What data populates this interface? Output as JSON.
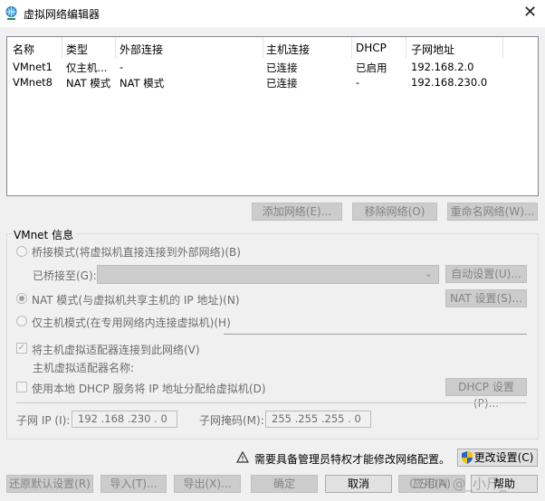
{
  "window": {
    "title": "虚拟网络编辑器",
    "icon": "globe-network-icon",
    "close": "✕"
  },
  "table": {
    "headers": [
      "名称",
      "类型",
      "外部连接",
      "主机连接",
      "DHCP",
      "子网地址"
    ],
    "rows": [
      [
        "VMnet1",
        "仅主机...",
        "-",
        "已连接",
        "已启用",
        "192.168.2.0"
      ],
      [
        "VMnet8",
        "NAT 模式",
        "NAT 模式",
        "已连接",
        "-",
        "192.168.230.0"
      ]
    ]
  },
  "list_buttons": {
    "add": "添加网络(E)...",
    "remove": "移除网络(O)",
    "rename": "重命名网络(W)..."
  },
  "vmnet_info": {
    "label": "VMnet 信息",
    "bridged": "桥接模式(将虚拟机直接连接到外部网络)(B)",
    "bridged_to": "已桥接至(G):",
    "bridged_to_value": "",
    "auto": "自动设置(U)...",
    "nat": "NAT 模式(与虚拟机共享主机的 IP 地址)(N)",
    "nat_settings": "NAT 设置(S)...",
    "nat_selected": true,
    "hostonly": "仅主机模式(在专用网络内连接虚拟机)(H)",
    "connect_adapter": "将主机虚拟适配器连接到此网络(V)",
    "connect_adapter_checked": true,
    "adapter_name": "主机虚拟适配器名称:",
    "dhcp": "使用本地 DHCP 服务将 IP 地址分配给虚拟机(D)",
    "dhcp_checked": false,
    "dhcp_settings": "DHCP 设置(P)...",
    "subnet_ip_label": "子网 IP (I):",
    "subnet_ip": "192 .168 .230 . 0",
    "mask_label": "子网掩码(M):",
    "mask": "255 .255 .255 . 0"
  },
  "warning": {
    "text": "需要具备管理员特权才能修改网络配置。",
    "icon": "warning-icon",
    "change": "更改设置(C)",
    "change_icon": "shield-icon"
  },
  "footer": {
    "restore": "还原默认设置(R)",
    "import": "导入(T)...",
    "export": "导出(X)...",
    "ok": "确定",
    "cancel": "取消",
    "apply": "应用(A)",
    "help": "帮助"
  },
  "watermark": "CSDN @_小斤_"
}
